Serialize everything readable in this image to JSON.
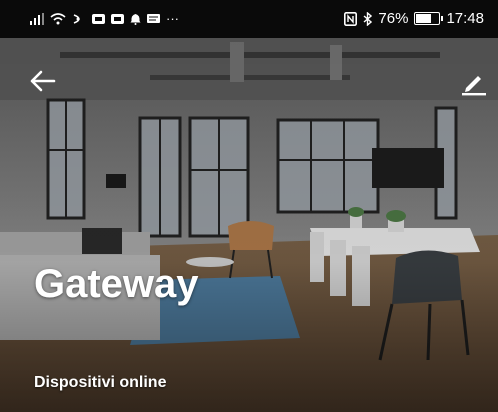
{
  "status_bar": {
    "left_icons": [
      "signal-icon",
      "wifi-icon",
      "hotspot-icon",
      "notification-icon",
      "notification-icon",
      "bell-icon",
      "message-icon"
    ],
    "more": "···",
    "nfc_icon": "nfc-icon",
    "bluetooth_icon": "bluetooth-icon",
    "battery_level": "76%",
    "battery_fraction": 0.76,
    "time": "17:48"
  },
  "header": {
    "back_icon": "arrow-left-icon",
    "edit_icon": "pencil-icon"
  },
  "device": {
    "name": "Gateway",
    "section_label": "Dispositivi online"
  },
  "colors": {
    "status_bar_bg": "#0a0a0a",
    "text": "#ffffff"
  }
}
